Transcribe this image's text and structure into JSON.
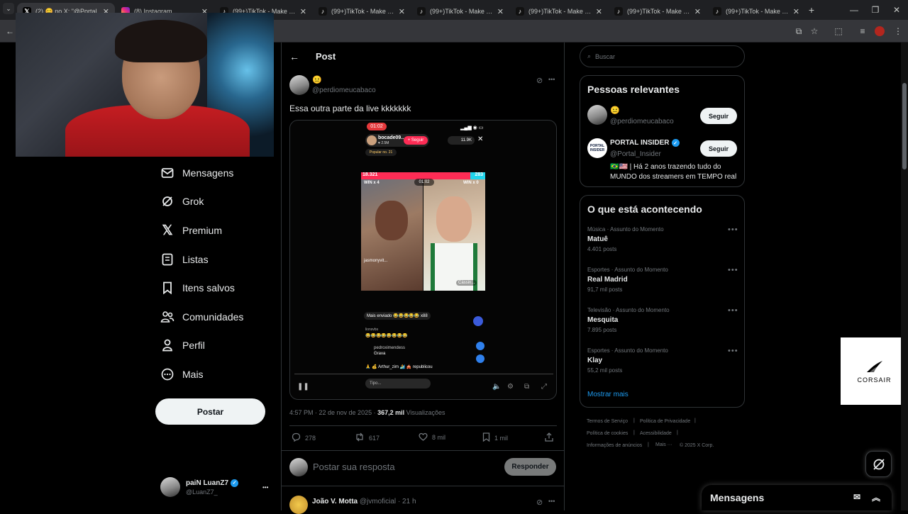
{
  "browser": {
    "tabs": [
      {
        "title": "(2) 😊 no X: \"@Portal",
        "icon": "x-logo-icon",
        "active": true
      },
      {
        "title": "(8) Instagram",
        "icon": "instagram-icon",
        "active": false
      },
      {
        "title": "(99+)TikTok - Make Your",
        "icon": "tiktok-icon",
        "active": false
      },
      {
        "title": "(99+)TikTok - Make Your",
        "icon": "tiktok-icon",
        "active": false
      },
      {
        "title": "(99+)TikTok - Make Your",
        "icon": "tiktok-icon",
        "active": false
      },
      {
        "title": "(99+)TikTok - Make Your",
        "icon": "tiktok-icon",
        "active": false
      },
      {
        "title": "(99+)TikTok - Make Your",
        "icon": "tiktok-icon",
        "active": false
      },
      {
        "title": "(99+)TikTok - Make Your",
        "icon": "tiktok-icon",
        "active": false
      }
    ],
    "new_tab": "+",
    "window_controls": [
      "—",
      "❐",
      "✕"
    ]
  },
  "nav": {
    "items": [
      {
        "label": "Mensagens",
        "icon": "envelope-icon"
      },
      {
        "label": "Grok",
        "icon": "grok-icon"
      },
      {
        "label": "Premium",
        "icon": "x-logo-icon"
      },
      {
        "label": "Listas",
        "icon": "list-icon"
      },
      {
        "label": "Itens salvos",
        "icon": "bookmark-icon"
      },
      {
        "label": "Comunidades",
        "icon": "communities-icon"
      },
      {
        "label": "Perfil",
        "icon": "person-icon"
      },
      {
        "label": "Mais",
        "icon": "more-circle-icon"
      }
    ],
    "post_button": "Postar",
    "account": {
      "name": "paiN LuanZ7",
      "handle": "@LuanZ7_",
      "more": "•••"
    }
  },
  "main": {
    "header_title": "Post",
    "tweet": {
      "author_emoji": "😐",
      "handle": "@perdiomeucabaco",
      "text": "Essa outra parte da live kkkkkkk",
      "time": "4:57 PM · 22 de nov de 2025 · ",
      "views_count": "367,2 mil",
      "views_label": " Visualizações",
      "actions": {
        "replies": "278",
        "reposts": "617",
        "likes": "8 mil",
        "bookmarks": "1 mil"
      },
      "media": {
        "live_timer": "01:02",
        "streamer_name": "bocade09...",
        "streamer_likes": "♥ 2.5M",
        "follow_label": "+ Seguir",
        "viewer_count": "11.9K",
        "popular_label": "Popular no. 21",
        "left_score": "18.321",
        "right_score": "283",
        "battle_timer": "01:02",
        "win_left": "WIN x 4",
        "win_right": "WIN x 0",
        "overlay_left": "jasmonyvit...",
        "overlay_right": "Cássin...",
        "chat": [
          {
            "user": "",
            "text": "Mais enviado 😂😂😂😂😂  x88"
          },
          {
            "user": "lionsvbs",
            "text": "😂😂😂😂😂😂😂😂"
          },
          {
            "user": "pedroximendess",
            "text": "Grava"
          },
          {
            "user": "",
            "text": "🙏 💰 Arthur_zim 🏄 🎪 republicou"
          }
        ],
        "input_placeholder": "Tipo..."
      }
    },
    "reply_placeholder": "Postar sua resposta",
    "reply_button": "Responder",
    "next_reply": {
      "name": "João V. Motta",
      "handle": "@jvmoficial",
      "time": "· 21 h"
    }
  },
  "sidebar": {
    "search_placeholder": "Buscar",
    "relevant": {
      "title": "Pessoas relevantes",
      "people": [
        {
          "name": "😐",
          "handle": "@perdiomeucabaco",
          "button": "Seguir"
        },
        {
          "name": "PORTAL INSIDER",
          "handle": "@Portal_Insider",
          "button": "Seguir",
          "bio_line1": "🇧🇷🇺🇸 | Há 2 anos trazendo tudo do",
          "bio_line2": "MUNDO dos streamers em TEMPO real"
        }
      ]
    },
    "trends": {
      "title": "O que está acontecendo",
      "items": [
        {
          "category": "Música · Assunto do Momento",
          "name": "Matuê",
          "count": "4.401 posts"
        },
        {
          "category": "Esportes · Assunto do Momento",
          "name": "Real Madrid",
          "count": "91,7 mil posts"
        },
        {
          "category": "Televisão · Assunto do Momento",
          "name": "Mesquita",
          "count": "7.895 posts"
        },
        {
          "category": "Esportes · Assunto do Momento",
          "name": "Klay",
          "count": "55,2 mil posts"
        }
      ],
      "show_more": "Mostrar mais"
    },
    "footer": {
      "links": [
        "Termos de Serviço",
        "Política de Privacidade",
        "Política de cookies",
        "Acessibilidade",
        "Informações de anúncios",
        "Mais ···"
      ],
      "copyright": "© 2025 X Corp."
    }
  },
  "overlay_brand": "CORSAIR",
  "messages_drawer": "Mensagens",
  "colors": {
    "accent": "#1d9bf0",
    "background": "#000000",
    "border": "#2f3336",
    "muted": "#71767b"
  }
}
